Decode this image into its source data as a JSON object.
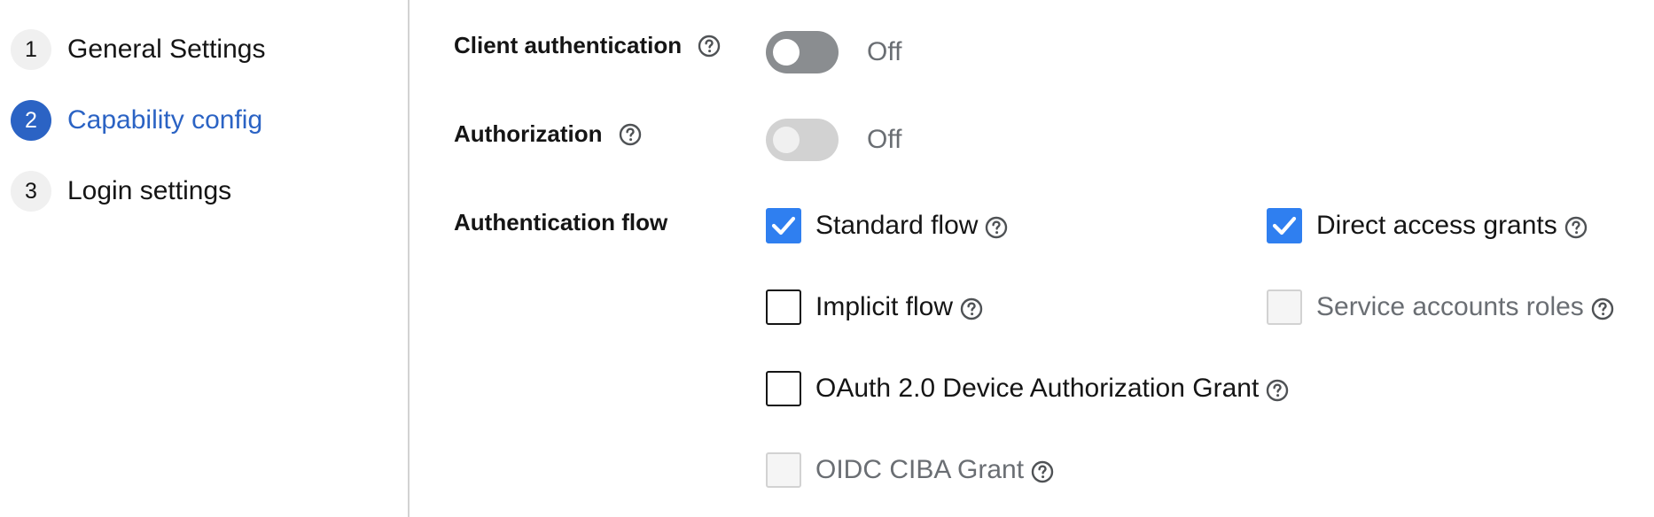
{
  "wizard_nav": {
    "steps": [
      {
        "number": "1",
        "label": "General Settings"
      },
      {
        "number": "2",
        "label": "Capability config"
      },
      {
        "number": "3",
        "label": "Login settings"
      }
    ],
    "active_step": 2
  },
  "form": {
    "client_authentication": {
      "label": "Client authentication",
      "state": "Off",
      "enabled": false,
      "disabled": false
    },
    "authorization": {
      "label": "Authorization",
      "state": "Off",
      "enabled": false,
      "disabled": true
    },
    "authentication_flow": {
      "label": "Authentication flow",
      "options": [
        {
          "label": "Standard flow",
          "checked": true,
          "disabled": false
        },
        {
          "label": "Direct access grants",
          "checked": true,
          "disabled": false
        },
        {
          "label": "Implicit flow",
          "checked": false,
          "disabled": false
        },
        {
          "label": "Service accounts roles",
          "checked": false,
          "disabled": true
        },
        {
          "label": "OAuth 2.0 Device Authorization Grant",
          "checked": false,
          "disabled": false
        },
        {
          "label": "OIDC CIBA Grant",
          "checked": false,
          "disabled": true
        }
      ]
    }
  },
  "icons": {
    "help": "help-circle-icon",
    "check": "checkmark-icon"
  },
  "colors": {
    "accent": "#2b63c4",
    "checkbox_checked": "#2f7ff0",
    "switch_off": "#8a8d90",
    "switch_disabled": "#d2d2d2",
    "muted_text": "#6a6e73"
  }
}
